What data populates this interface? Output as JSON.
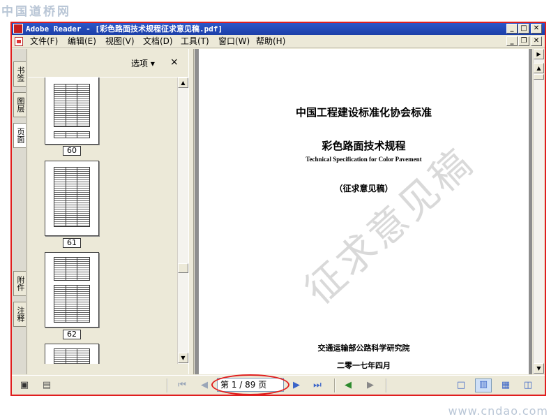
{
  "site": {
    "logo_text": "中国道桥网",
    "url": "www.cndao.com"
  },
  "window": {
    "title": "Adobe Reader - [彩色路面技术规程征求意见稿.pdf]",
    "controls": {
      "minimize": "_",
      "maximize": "□",
      "close": "✕",
      "restore": "❐"
    }
  },
  "menu": {
    "items": [
      {
        "label": "文件(F)"
      },
      {
        "label": "编辑(E)"
      },
      {
        "label": "视图(V)"
      },
      {
        "label": "文档(D)"
      },
      {
        "label": "工具(T)"
      },
      {
        "label": "窗口(W)"
      },
      {
        "label": "帮助(H)"
      }
    ]
  },
  "side_tabs": {
    "bookmarks": "书签",
    "layers": "图层",
    "pages": "页面",
    "attachments": "附件",
    "comments": "注释"
  },
  "panel": {
    "options_label": "选项",
    "close_glyph": "×",
    "thumbnails": [
      {
        "page": "60"
      },
      {
        "page": "61"
      },
      {
        "page": "62"
      }
    ]
  },
  "document": {
    "organization": "中国工程建设标准化协会标准",
    "title": "彩色路面技术规程",
    "subtitle": "Technical Specification for Color Pavement",
    "draft_note": "（征求意见稿）",
    "institute": "交通运输部公路科学研究院",
    "date": "二零一七年四月",
    "watermark": "征求意见稿"
  },
  "statusbar": {
    "page_indicator": "第 1 / 89 页",
    "current_page": 1,
    "total_pages": 89
  },
  "colors": {
    "accent": "#e01e1e",
    "titlebar": "#2b56c9",
    "chrome": "#ece9d8"
  }
}
